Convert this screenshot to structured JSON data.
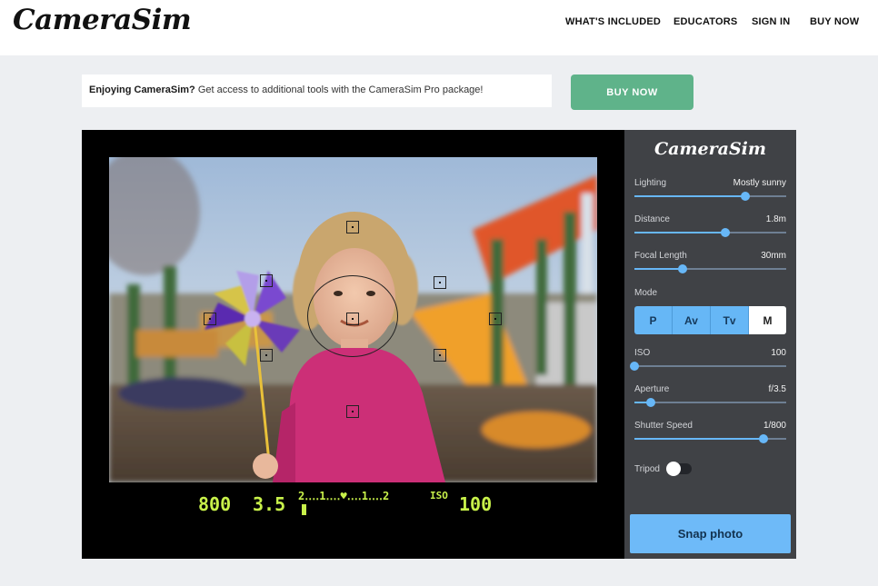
{
  "header": {
    "logo": "CameraSim",
    "nav": [
      "WHAT'S INCLUDED",
      "EDUCATORS",
      "SIGN IN",
      "BUY NOW"
    ]
  },
  "promo": {
    "bold": "Enjoying CameraSim?",
    "text": " Get access to additional tools with the CameraSim Pro package!",
    "button": "BUY NOW"
  },
  "viewfinder": {
    "shutter": "800",
    "aperture": "3.5",
    "meter_scale": "2‥‥1‥‥♥‥‥1‥‥2",
    "iso_label": "ISO",
    "iso": "100"
  },
  "panel": {
    "logo": "CameraSim",
    "controls": [
      {
        "label": "Lighting",
        "value": "Mostly sunny",
        "level": 0.73
      },
      {
        "label": "Distance",
        "value": "1.8m",
        "level": 0.6
      },
      {
        "label": "Focal Length",
        "value": "30mm",
        "level": 0.32
      }
    ],
    "mode_label": "Mode",
    "modes": [
      "P",
      "Av",
      "Tv",
      "M"
    ],
    "active_mode": "M",
    "exposure": [
      {
        "label": "ISO",
        "value": "100",
        "level": 0.0
      },
      {
        "label": "Aperture",
        "value": "f/3.5",
        "level": 0.11
      },
      {
        "label": "Shutter Speed",
        "value": "1/800",
        "level": 0.85
      }
    ],
    "tripod_label": "Tripod",
    "tripod_on": false,
    "snap": "Snap photo"
  },
  "colors": {
    "accent": "#67b7f7",
    "promo_button": "#5fb38a",
    "lcd": "#c8f14a",
    "panel_bg": "#404246"
  }
}
